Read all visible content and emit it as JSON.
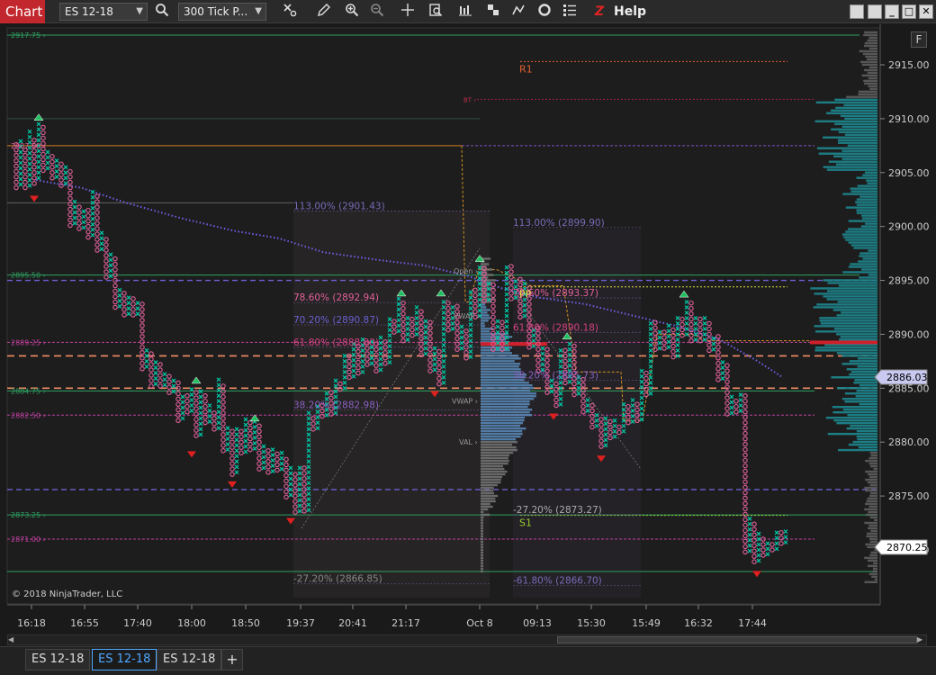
{
  "toolbar": {
    "chart_label": "Chart",
    "instrument": "ES 12-18",
    "period": "300 Tick P...",
    "help": "Help"
  },
  "colors": {
    "background": "#1a1a1a",
    "up_box": "#00c8a8",
    "down_box": "#e0609a",
    "vwap": "#7060e8",
    "pivot": "#e06030",
    "support": "#9acd32",
    "volume_profile": "#1ea8a8"
  },
  "chart": {
    "copyright": "© 2018 NinjaTrader, LLC",
    "f_button": "F",
    "price_axis": [
      "2915.00",
      "2910.00",
      "2905.00",
      "2900.00",
      "2895.00",
      "2890.00",
      "2885.00",
      "2880.00",
      "2875.00",
      "2870.00"
    ],
    "time_axis": [
      "16:18",
      "16:55",
      "17:40",
      "18:00",
      "18:50",
      "19:37",
      "20:41",
      "21:17",
      "Oct 8",
      "09:13",
      "15:30",
      "15:49",
      "16:32",
      "17:44"
    ],
    "price_tags": [
      "2886.03",
      "2870.25"
    ],
    "left_price_labels": [
      "2917.75",
      "2907.50",
      "2895.50",
      "2889.25",
      "2884.75",
      "2882.50",
      "2873.25",
      "2871.00"
    ],
    "fib_left": [
      "113.00% (2901.43)",
      "78.60% (2892.94)",
      "70.20% (2890.87)",
      "61.80% (2888.80)",
      "38.20% (2882.98)",
      "-27.20% (2866.85)"
    ],
    "fib_right": [
      "113.00% (2899.90)",
      "78.60% (2893.37)",
      "61.80% (2890.18)",
      "38.20% (2885.73)",
      "-27.20% (2873.27)",
      "-61.80% (2866.70)"
    ],
    "pivots": {
      "r1": "R1",
      "pp": "PP",
      "s1": "S1",
      "bt": "BT"
    },
    "profile_labels": [
      "Open",
      "VWAP",
      "VWAP",
      "VAL"
    ]
  },
  "tabs": [
    "ES 12-18",
    "ES 12-18",
    "ES 12-18"
  ],
  "add_tab": "+"
}
